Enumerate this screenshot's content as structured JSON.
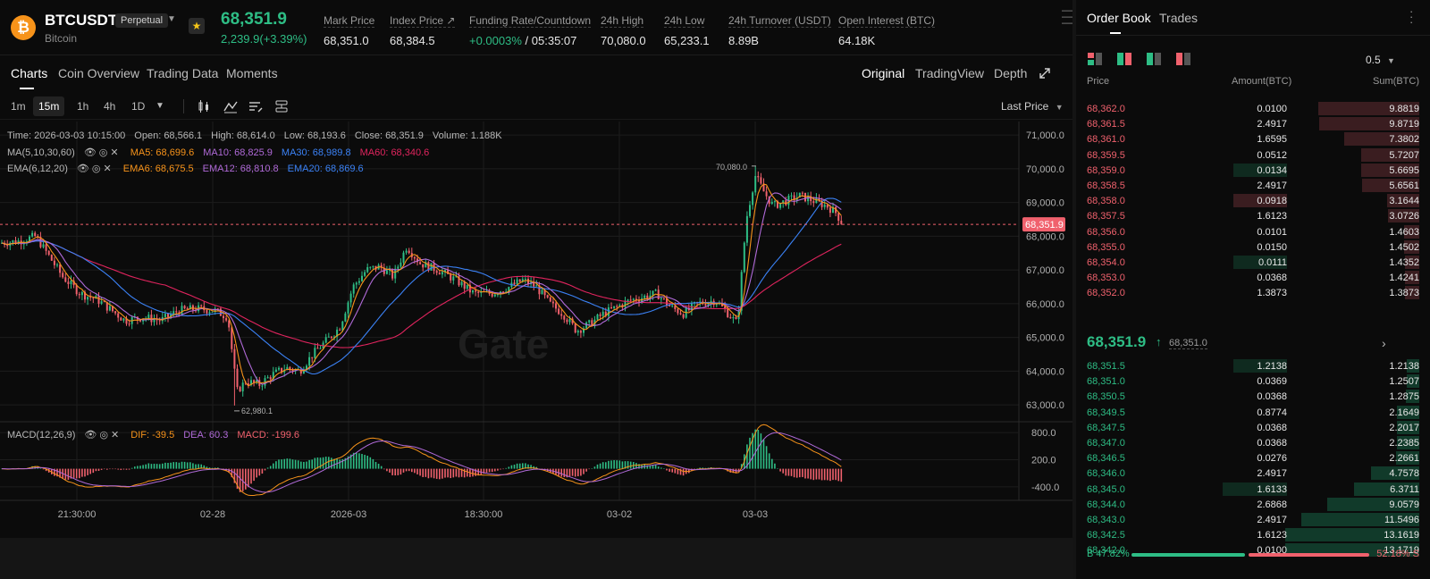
{
  "header": {
    "coin_logo": "₿",
    "symbol": "BTCUSDT",
    "subtitle": "Bitcoin",
    "badge": "Perpetual",
    "last_price": "68,351.9",
    "change": "2,239.9(+3.39%)",
    "stats": [
      {
        "label": "Mark Price",
        "value": "68,351.0"
      },
      {
        "label": "Index Price ↗",
        "value": "68,384.5"
      },
      {
        "label": "Funding Rate/Countdown",
        "value_green": "+0.0003%",
        "value": "/ 05:35:07"
      },
      {
        "label": "24h High",
        "value": "70,080.0"
      },
      {
        "label": "24h Low",
        "value": "65,233.1"
      },
      {
        "label": "24h Turnover (USDT)",
        "value": "8.89B"
      },
      {
        "label": "Open Interest (BTC)",
        "value": "64.18K"
      }
    ]
  },
  "tabs": {
    "items": [
      "Charts",
      "Coin Overview",
      "Trading Data",
      "Moments"
    ],
    "active": "Charts",
    "views": [
      "Original",
      "TradingView",
      "Depth"
    ],
    "active_view": "Original"
  },
  "toolbar": {
    "intervals": [
      "1m",
      "15m",
      "1h",
      "4h",
      "1D"
    ],
    "active_interval": "15m",
    "price_type": "Last Price"
  },
  "legend": {
    "ohlc": {
      "time": "Time: 2026-03-03 10:15:00",
      "open": "Open: 68,566.1",
      "high": "High: 68,614.0",
      "low": "Low: 68,193.6",
      "close": "Close: 68,351.9",
      "volume": "Volume: 1.188K"
    },
    "ma": {
      "title": "MA(5,10,30,60)",
      "ma5": "MA5: 68,699.6",
      "ma10": "MA10: 68,825.9",
      "ma30": "MA30: 68,989.8",
      "ma60": "MA60: 68,340.6"
    },
    "ema": {
      "title": "EMA(6,12,20)",
      "ema6": "EMA6: 68,675.5",
      "ema12": "EMA12: 68,810.8",
      "ema20": "EMA20: 68,869.6"
    },
    "macd": {
      "title": "MACD(12,26,9)",
      "dif": "DIF: -39.5",
      "dea": "DEA: 60.3",
      "macd": "MACD: -199.6"
    }
  },
  "chart_data": {
    "type": "candlestick",
    "watermark": "Gate",
    "price_axis": [
      "71,000.0",
      "70,000.0",
      "69,000.0",
      "68,000.0",
      "67,000.0",
      "66,000.0",
      "65,000.0",
      "64,000.0",
      "63,000.0"
    ],
    "price_values": [
      71000,
      70000,
      69000,
      68000,
      67000,
      66000,
      65000,
      64000,
      63000
    ],
    "ylim": [
      62500,
      71400
    ],
    "time_axis": [
      "21:30:00",
      "02-28",
      "2026-03",
      "18:30:00",
      "03-02",
      "03-03"
    ],
    "last_price_tag": "68,351.9",
    "last_price": 68351.9,
    "high_marker": {
      "label": "70,080.0",
      "value": 70080
    },
    "low_marker": {
      "label": "62,980.1",
      "value": 62980.1
    },
    "macd_axis": [
      "800.0",
      "200.0",
      "-400.0"
    ],
    "macd_values": [
      800,
      200,
      -400
    ],
    "macd_ylim": [
      -700,
      1000
    ],
    "series_colors": {
      "ma5": "#f7931a",
      "ma10": "#b06ad8",
      "ma30": "#3b82f6",
      "ma60": "#e0245e",
      "up": "#2ebd85",
      "down": "#f0616d",
      "dif": "#f7931a",
      "dea": "#b06ad8"
    },
    "close_path": [
      [
        0,
        67800
      ],
      [
        20,
        67850
      ],
      [
        40,
        68000
      ],
      [
        55,
        67400
      ],
      [
        70,
        66800
      ],
      [
        90,
        66300
      ],
      [
        110,
        66100
      ],
      [
        125,
        65800
      ],
      [
        140,
        65500
      ],
      [
        160,
        65600
      ],
      [
        180,
        65500
      ],
      [
        200,
        65800
      ],
      [
        220,
        65850
      ],
      [
        240,
        65800
      ],
      [
        255,
        65600
      ],
      [
        265,
        63400
      ],
      [
        275,
        63700
      ],
      [
        290,
        63600
      ],
      [
        305,
        63900
      ],
      [
        320,
        64100
      ],
      [
        335,
        64000
      ],
      [
        350,
        64500
      ],
      [
        365,
        64900
      ],
      [
        380,
        65300
      ],
      [
        395,
        66500
      ],
      [
        410,
        67000
      ],
      [
        425,
        67100
      ],
      [
        440,
        66800
      ],
      [
        455,
        67700
      ],
      [
        470,
        67200
      ],
      [
        490,
        67000
      ],
      [
        510,
        66700
      ],
      [
        530,
        66300
      ],
      [
        550,
        66300
      ],
      [
        570,
        66500
      ],
      [
        585,
        66700
      ],
      [
        600,
        66500
      ],
      [
        615,
        66000
      ],
      [
        630,
        65700
      ],
      [
        645,
        65200
      ],
      [
        660,
        65400
      ],
      [
        675,
        65700
      ],
      [
        690,
        65900
      ],
      [
        705,
        66100
      ],
      [
        720,
        66200
      ],
      [
        735,
        66300
      ],
      [
        750,
        65900
      ],
      [
        765,
        65700
      ],
      [
        780,
        66000
      ],
      [
        800,
        66100
      ],
      [
        815,
        65700
      ],
      [
        825,
        65400
      ],
      [
        835,
        68500
      ],
      [
        845,
        69800
      ],
      [
        855,
        69300
      ],
      [
        865,
        68900
      ],
      [
        875,
        69000
      ],
      [
        885,
        69100
      ],
      [
        895,
        69200
      ],
      [
        905,
        69100
      ],
      [
        915,
        69000
      ],
      [
        925,
        68900
      ],
      [
        935,
        68700
      ],
      [
        943,
        68352
      ]
    ]
  },
  "orderbook": {
    "tabs": [
      "Order Book",
      "Trades"
    ],
    "active_tab": "Order Book",
    "precision": "0.5",
    "columns": [
      "Price",
      "Amount(BTC)",
      "Sum(BTC)"
    ],
    "asks": [
      {
        "price": "68,362.0",
        "amount": "0.0100",
        "sum": "9.8819",
        "amt": 0.01,
        "tot": 9.8819
      },
      {
        "price": "68,361.5",
        "amount": "2.4917",
        "sum": "9.8719",
        "amt": 2.4917,
        "tot": 9.8719
      },
      {
        "price": "68,361.0",
        "amount": "1.6595",
        "sum": "7.3802",
        "amt": 1.6595,
        "tot": 7.3802
      },
      {
        "price": "68,359.5",
        "amount": "0.0512",
        "sum": "5.7207",
        "amt": 0.0512,
        "tot": 5.7207
      },
      {
        "price": "68,359.0",
        "amount": "0.0134",
        "sum": "5.6695",
        "amt": 0.0134,
        "tot": 5.6695,
        "hl": "green"
      },
      {
        "price": "68,358.5",
        "amount": "2.4917",
        "sum": "5.6561",
        "amt": 2.4917,
        "tot": 5.6561
      },
      {
        "price": "68,358.0",
        "amount": "0.0918",
        "sum": "3.1644",
        "amt": 0.0918,
        "tot": 3.1644,
        "hl": "red"
      },
      {
        "price": "68,357.5",
        "amount": "1.6123",
        "sum": "3.0726",
        "amt": 1.6123,
        "tot": 3.0726
      },
      {
        "price": "68,356.0",
        "amount": "0.0101",
        "sum": "1.4603",
        "amt": 0.0101,
        "tot": 1.4603
      },
      {
        "price": "68,355.0",
        "amount": "0.0150",
        "sum": "1.4502",
        "amt": 0.015,
        "tot": 1.4502
      },
      {
        "price": "68,354.0",
        "amount": "0.0111",
        "sum": "1.4352",
        "amt": 0.0111,
        "tot": 1.4352,
        "hl": "green"
      },
      {
        "price": "68,353.0",
        "amount": "0.0368",
        "sum": "1.4241",
        "amt": 0.0368,
        "tot": 1.4241
      },
      {
        "price": "68,352.0",
        "amount": "1.3873",
        "sum": "1.3873",
        "amt": 1.3873,
        "tot": 1.3873
      }
    ],
    "mid_price": "68,351.9",
    "mid_arrow": "↑",
    "mark_price": "68,351.0",
    "bids": [
      {
        "price": "68,351.5",
        "amount": "1.2138",
        "sum": "1.2138",
        "amt": 1.2138,
        "tot": 1.2138,
        "hl": "green"
      },
      {
        "price": "68,351.0",
        "amount": "0.0369",
        "sum": "1.2507",
        "amt": 0.0369,
        "tot": 1.2507
      },
      {
        "price": "68,350.5",
        "amount": "0.0368",
        "sum": "1.2875",
        "amt": 0.0368,
        "tot": 1.2875
      },
      {
        "price": "68,349.5",
        "amount": "0.8774",
        "sum": "2.1649",
        "amt": 0.8774,
        "tot": 2.1649
      },
      {
        "price": "68,347.5",
        "amount": "0.0368",
        "sum": "2.2017",
        "amt": 0.0368,
        "tot": 2.2017
      },
      {
        "price": "68,347.0",
        "amount": "0.0368",
        "sum": "2.2385",
        "amt": 0.0368,
        "tot": 2.2385
      },
      {
        "price": "68,346.5",
        "amount": "0.0276",
        "sum": "2.2661",
        "amt": 0.0276,
        "tot": 2.2661
      },
      {
        "price": "68,346.0",
        "amount": "2.4917",
        "sum": "4.7578",
        "amt": 2.4917,
        "tot": 4.7578
      },
      {
        "price": "68,345.0",
        "amount": "1.6133",
        "sum": "6.3711",
        "amt": 1.6133,
        "tot": 6.3711,
        "hl": "green"
      },
      {
        "price": "68,344.0",
        "amount": "2.6868",
        "sum": "9.0579",
        "amt": 2.6868,
        "tot": 9.0579
      },
      {
        "price": "68,343.0",
        "amount": "2.4917",
        "sum": "11.5496",
        "amt": 2.4917,
        "tot": 11.5496
      },
      {
        "price": "68,342.5",
        "amount": "1.6123",
        "sum": "13.1619",
        "amt": 1.6123,
        "tot": 13.1619
      },
      {
        "price": "68,342.0",
        "amount": "0.0100",
        "sum": "13.1719",
        "amt": 0.01,
        "tot": 13.1719
      }
    ],
    "buy_ratio": "B 47.82%",
    "sell_ratio": "52.18% S",
    "buy_pct": 47.82,
    "sell_pct": 52.18
  },
  "colors": {
    "green": "#2ebd85",
    "red": "#f0616d",
    "accent": "#f7931a"
  }
}
